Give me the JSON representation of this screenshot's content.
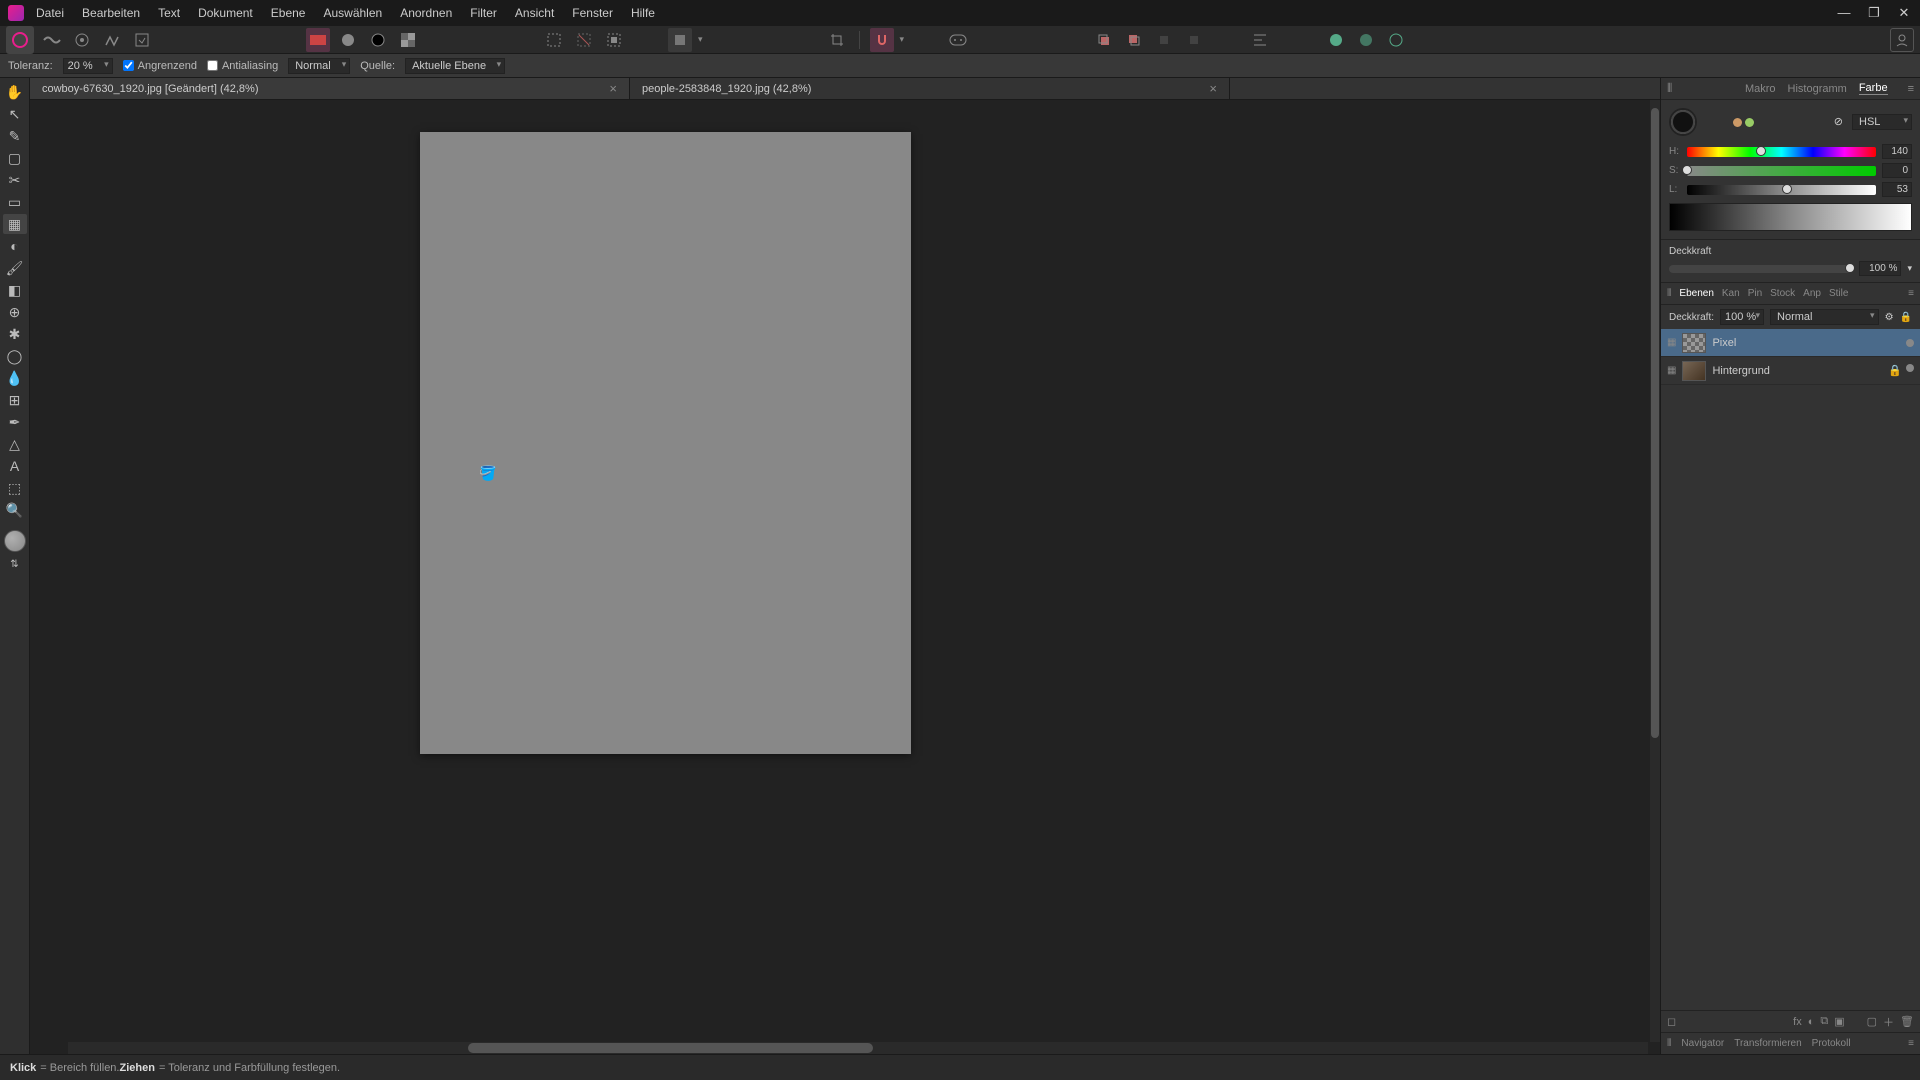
{
  "menu": [
    "Datei",
    "Bearbeiten",
    "Text",
    "Dokument",
    "Ebene",
    "Auswählen",
    "Anordnen",
    "Filter",
    "Ansicht",
    "Fenster",
    "Hilfe"
  ],
  "context": {
    "tolerance_label": "Toleranz:",
    "tolerance_value": "20 %",
    "contiguous": "Angrenzend",
    "antialias": "Antialiasing",
    "blend": "Normal",
    "source_label": "Quelle:",
    "source_value": "Aktuelle Ebene"
  },
  "tabs": [
    {
      "title": "cowboy-67630_1920.jpg [Geändert] (42,8%)",
      "active": true
    },
    {
      "title": "people-2583848_1920.jpg (42,8%)",
      "active": false
    }
  ],
  "right_top_tabs": [
    "Makro",
    "Histogramm",
    "Farbe"
  ],
  "color": {
    "mode": "HSL",
    "h_label": "H:",
    "h_val": "140",
    "s_label": "S:",
    "s_val": "0",
    "l_label": "L:",
    "l_val": "53"
  },
  "opacity": {
    "label": "Deckkraft",
    "value": "100 %"
  },
  "layers": {
    "tabs": [
      "Ebenen",
      "Kan",
      "Pin",
      "Stock",
      "Anp",
      "Stile"
    ],
    "opacity_label": "Deckkraft:",
    "opacity_val": "100 %",
    "blend": "Normal",
    "items": [
      {
        "name": "Pixel",
        "selected": true,
        "thumb": "checker"
      },
      {
        "name": "Hintergrund",
        "selected": false,
        "thumb": "img"
      }
    ]
  },
  "bottom_tabs": [
    "Navigator",
    "Transformieren",
    "Protokoll"
  ],
  "status": {
    "k1": "Klick",
    "t1": " = Bereich füllen. ",
    "k2": "Ziehen",
    "t2": " = Toleranz und Farbfüllung festlegen."
  }
}
